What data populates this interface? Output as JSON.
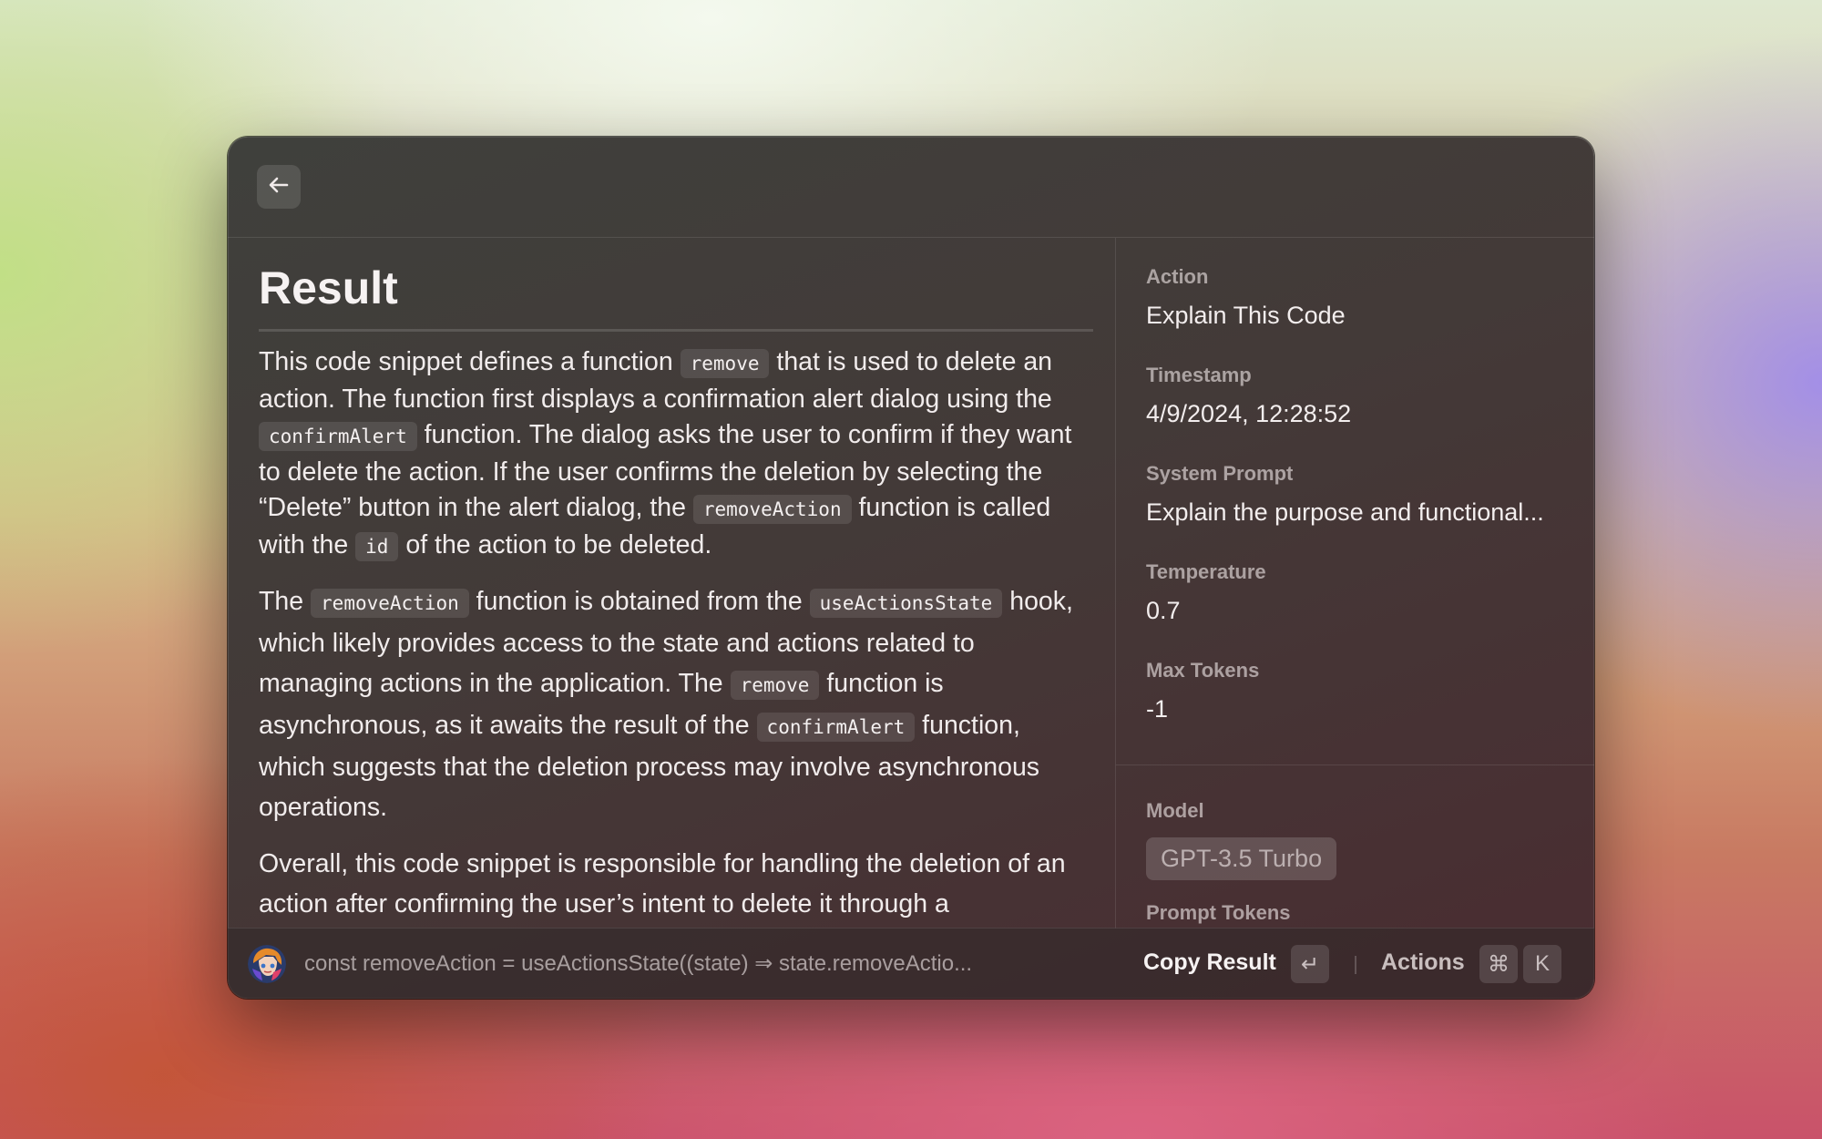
{
  "header": {
    "back_icon": "arrow-left-icon"
  },
  "result": {
    "title": "Result",
    "paragraphs": [
      {
        "parts": [
          "This code snippet defines a function ",
          "remove",
          " that is used to delete an action. The function first displays a confirmation alert dialog using the ",
          "confirmAlert",
          " function. The dialog asks the user to confirm if they want to delete the action. If the user confirms the deletion by selecting the “Delete” button in the alert dialog, the ",
          "removeAction",
          " function is called with the ",
          "id",
          " of the action to be deleted."
        ]
      },
      {
        "parts": [
          "The ",
          "removeAction",
          " function is obtained from the ",
          "useActionsState",
          " hook, which likely provides access to the state and actions related to managing actions in the application. The ",
          "remove",
          " function is asynchronous, as it awaits the result of the ",
          "confirmAlert",
          " function, which suggests that the deletion process may involve asynchronous operations."
        ]
      },
      {
        "text": "Overall, this code snippet is responsible for handling the deletion of an action after confirming the user’s intent to delete it through a"
      }
    ]
  },
  "metadata": {
    "action_label": "Action",
    "action_value": "Explain This Code",
    "timestamp_label": "Timestamp",
    "timestamp_value": "4/9/2024, 12:28:52",
    "system_prompt_label": "System Prompt",
    "system_prompt_value": "Explain the purpose and functional...",
    "temperature_label": "Temperature",
    "temperature_value": "0.7",
    "max_tokens_label": "Max Tokens",
    "max_tokens_value": "-1",
    "model_label": "Model",
    "model_value": "GPT-3.5 Turbo",
    "prompt_tokens_label": "Prompt Tokens"
  },
  "footer": {
    "source_text": "const removeAction = useActionsState((state) ⇒ state.removeActio...",
    "copy_result_label": "Copy Result",
    "enter_key": "↵",
    "actions_label": "Actions",
    "cmd_key": "⌘",
    "k_key": "K"
  },
  "colors": {
    "window_bg": "#433a38",
    "text": "#f2eeee",
    "muted": "#b5aaaa"
  }
}
